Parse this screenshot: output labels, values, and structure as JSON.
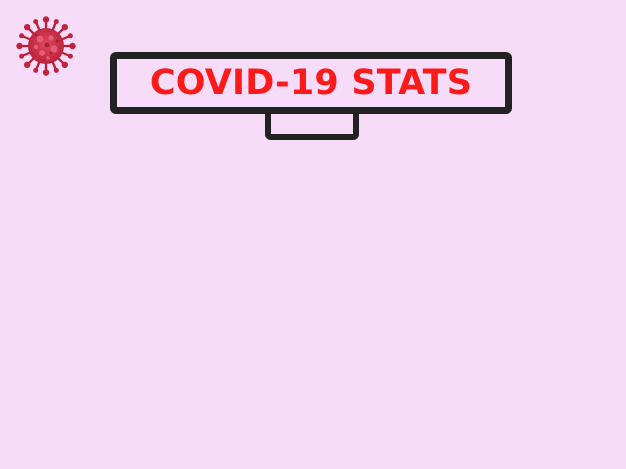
{
  "header": {
    "title": "COVID-19 STATS",
    "logo_icon": "virus-icon"
  },
  "theme": {
    "background": "#f6dcf9",
    "title_color": "#ff1a1a",
    "border_color": "#222222",
    "virus_color": "#c0243c"
  }
}
